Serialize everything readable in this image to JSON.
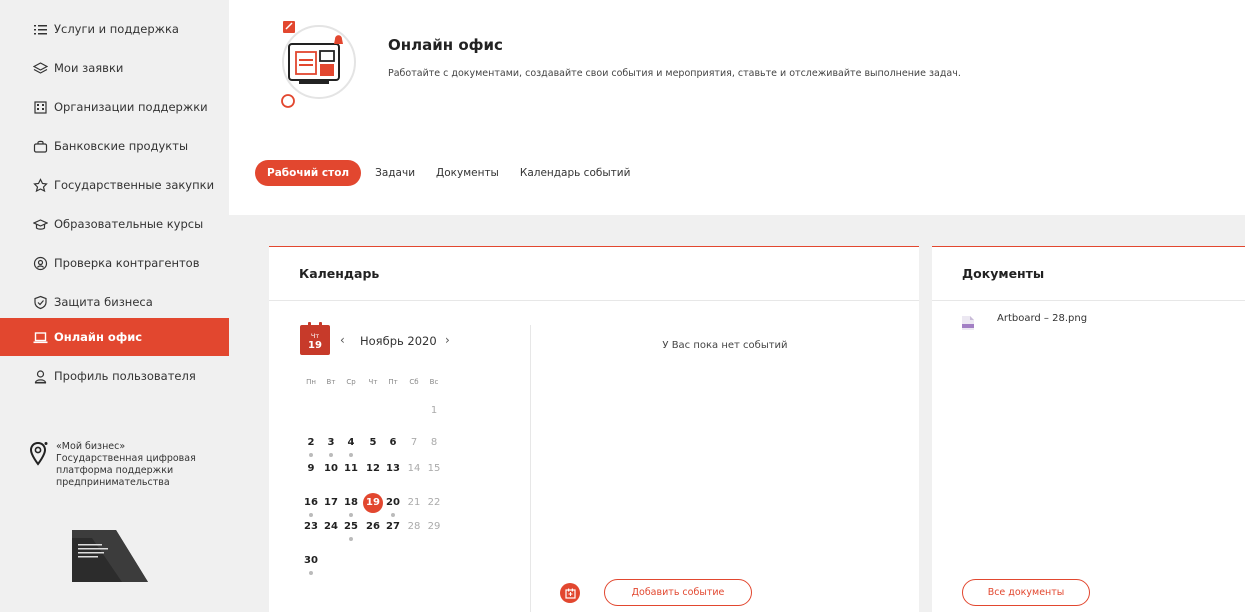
{
  "sidebar": {
    "items": [
      {
        "label": "Услуги и поддержка",
        "icon": "list-icon",
        "active": false
      },
      {
        "label": "Мои заявки",
        "icon": "layers-icon",
        "active": false
      },
      {
        "label": "Организации поддержки",
        "icon": "building-icon",
        "active": false
      },
      {
        "label": "Банковские продукты",
        "icon": "bag-icon",
        "active": false
      },
      {
        "label": "Государственные закупки",
        "icon": "emblem-icon",
        "active": false
      },
      {
        "label": "Образовательные курсы",
        "icon": "graduation-cap-icon",
        "active": false
      },
      {
        "label": "Проверка контрагентов",
        "icon": "search-badge-icon",
        "active": false
      },
      {
        "label": "Защита бизнеса",
        "icon": "shield-icon",
        "active": false
      },
      {
        "label": "Онлайн офис",
        "icon": "laptop-icon",
        "active": true
      },
      {
        "label": "Профиль пользователя",
        "icon": "user-icon",
        "active": false
      }
    ],
    "platform": {
      "line1": "«Мой бизнес»",
      "line2": "Государственная цифровая",
      "line3": "платформа поддержки",
      "line4": "предпринимательства"
    }
  },
  "header": {
    "title": "Онлайн офис",
    "description": "Работайте с документами, создавайте свои события и мероприятия, ставьте и отслеживайте выполнение задач."
  },
  "tabs": [
    {
      "label": "Рабочий стол",
      "active": true
    },
    {
      "label": "Задачи",
      "active": false
    },
    {
      "label": "Документы",
      "active": false
    },
    {
      "label": "Календарь событий",
      "active": false
    }
  ],
  "calendar": {
    "card_title": "Календарь",
    "badge_weekday": "Чт",
    "badge_day": "19",
    "month_label": "Ноябрь 2020",
    "prev": "‹",
    "next": "›",
    "weekdays": [
      "Пн",
      "Вт",
      "Ср",
      "Чт",
      "Пт",
      "Сб",
      "Вс"
    ],
    "weeks": [
      [
        null,
        null,
        null,
        null,
        null,
        null,
        {
          "d": "1",
          "weekend": true
        }
      ],
      [
        {
          "d": "2",
          "dot": true
        },
        {
          "d": "3",
          "dot": true
        },
        {
          "d": "4",
          "dot": true
        },
        {
          "d": "5"
        },
        {
          "d": "6"
        },
        {
          "d": "7",
          "weekend": true
        },
        {
          "d": "8",
          "weekend": true
        }
      ],
      [
        {
          "d": "9"
        },
        {
          "d": "10"
        },
        {
          "d": "11"
        },
        {
          "d": "12"
        },
        {
          "d": "13"
        },
        {
          "d": "14",
          "weekend": true
        },
        {
          "d": "15",
          "weekend": true
        }
      ],
      [
        {
          "d": "16",
          "dot": true
        },
        {
          "d": "17"
        },
        {
          "d": "18",
          "dot": true
        },
        {
          "d": "19",
          "today": true
        },
        {
          "d": "20",
          "dot": true
        },
        {
          "d": "21",
          "weekend": true
        },
        {
          "d": "22",
          "weekend": true
        }
      ],
      [
        {
          "d": "23"
        },
        {
          "d": "24"
        },
        {
          "d": "25",
          "dot": true
        },
        {
          "d": "26"
        },
        {
          "d": "27"
        },
        {
          "d": "28",
          "weekend": true
        },
        {
          "d": "29",
          "weekend": true
        }
      ],
      [
        {
          "d": "30",
          "dot": true
        },
        null,
        null,
        null,
        null,
        null,
        null
      ]
    ],
    "no_events": "У Вас пока нет событий",
    "add_event_label": "Добавить событие"
  },
  "documents": {
    "card_title": "Документы",
    "files": [
      {
        "name": "Artboard – 28.png",
        "icon": "image-file-icon"
      }
    ],
    "all_label": "Все документы"
  },
  "colors": {
    "accent": "#e2472f",
    "background": "#f0f0f0"
  }
}
